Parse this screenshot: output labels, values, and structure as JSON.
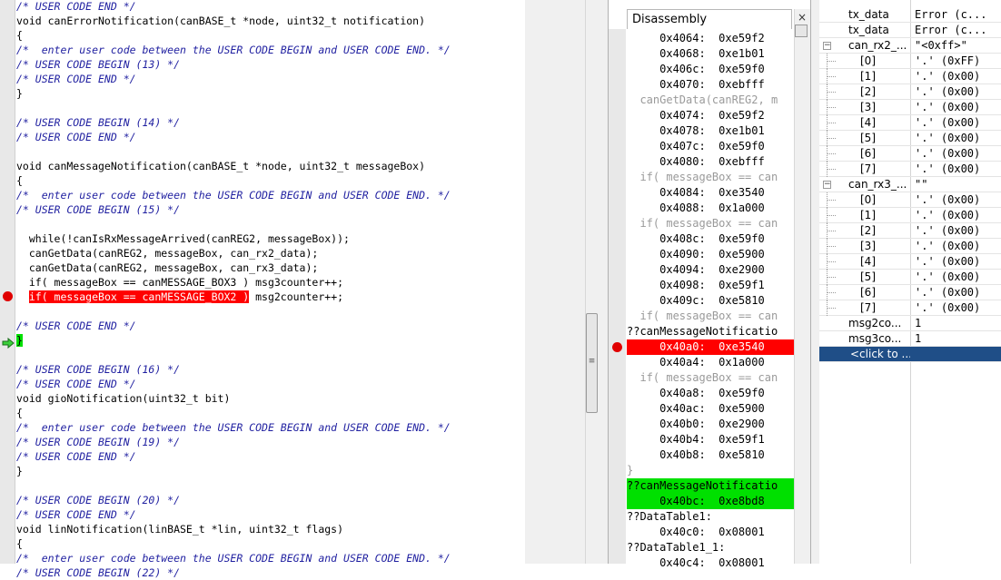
{
  "editor": {
    "lines": [
      {
        "text": "/* USER CODE END */",
        "style": "comment"
      },
      {
        "text": "void canErrorNotification(canBASE_t *node, uint32_t notification)",
        "style": "code"
      },
      {
        "text": "{",
        "style": "code"
      },
      {
        "text": "/*  enter user code between the USER CODE BEGIN and USER CODE END. */",
        "style": "comment"
      },
      {
        "text": "/* USER CODE BEGIN (13) */",
        "style": "comment"
      },
      {
        "text": "/* USER CODE END */",
        "style": "comment"
      },
      {
        "text": "}",
        "style": "code"
      },
      {
        "text": "",
        "style": "code"
      },
      {
        "text": "/* USER CODE BEGIN (14) */",
        "style": "comment"
      },
      {
        "text": "/* USER CODE END */",
        "style": "comment"
      },
      {
        "text": "",
        "style": "code"
      },
      {
        "text": "void canMessageNotification(canBASE_t *node, uint32_t messageBox)",
        "style": "code"
      },
      {
        "text": "{",
        "style": "code"
      },
      {
        "text": "/*  enter user code between the USER CODE BEGIN and USER CODE END. */",
        "style": "comment"
      },
      {
        "text": "/* USER CODE BEGIN (15) */",
        "style": "comment"
      },
      {
        "text": "",
        "style": "code"
      },
      {
        "text": "  while(!canIsRxMessageArrived(canREG2, messageBox));",
        "style": "code"
      },
      {
        "text": "  canGetData(canREG2, messageBox, can_rx2_data);",
        "style": "code"
      },
      {
        "text": "  canGetData(canREG2, messageBox, can_rx3_data);",
        "style": "code"
      },
      {
        "text": "  if( messageBox == canMESSAGE_BOX3 ) msg3counter++;",
        "style": "code"
      },
      {
        "text": "  if( messageBox == canMESSAGE_BOX2 ) msg2counter++;",
        "style": "red",
        "hl": "if( messageBox == canMESSAGE_BOX2 )",
        "rest": " msg2counter++;"
      },
      {
        "text": "",
        "style": "code"
      },
      {
        "text": "/* USER CODE END */",
        "style": "comment"
      },
      {
        "text": "}",
        "style": "green"
      },
      {
        "text": "",
        "style": "code"
      },
      {
        "text": "/* USER CODE BEGIN (16) */",
        "style": "comment"
      },
      {
        "text": "/* USER CODE END */",
        "style": "comment"
      },
      {
        "text": "void gioNotification(uint32_t bit)",
        "style": "code"
      },
      {
        "text": "{",
        "style": "code"
      },
      {
        "text": "/*  enter user code between the USER CODE BEGIN and USER CODE END. */",
        "style": "comment"
      },
      {
        "text": "/* USER CODE BEGIN (19) */",
        "style": "comment"
      },
      {
        "text": "/* USER CODE END */",
        "style": "comment"
      },
      {
        "text": "}",
        "style": "code"
      },
      {
        "text": "",
        "style": "code"
      },
      {
        "text": "/* USER CODE BEGIN (20) */",
        "style": "comment"
      },
      {
        "text": "/* USER CODE END */",
        "style": "comment"
      },
      {
        "text": "void linNotification(linBASE_t *lin, uint32_t flags)",
        "style": "code"
      },
      {
        "text": "{",
        "style": "code"
      },
      {
        "text": "/*  enter user code between the USER CODE BEGIN and USER CODE END. */",
        "style": "comment"
      },
      {
        "text": "/* USER CODE BEGIN (22) */",
        "style": "comment"
      }
    ]
  },
  "disassembly": {
    "title": "Disassembly",
    "close_glyph": "×",
    "lines": [
      {
        "text": "     0x4064:  0xe59f2",
        "style": "addr"
      },
      {
        "text": "     0x4068:  0xe1b01",
        "style": "addr"
      },
      {
        "text": "     0x406c:  0xe59f0",
        "style": "addr"
      },
      {
        "text": "     0x4070:  0xebfff",
        "style": "addr"
      },
      {
        "text": "  canGetData(canREG2, m",
        "style": "src"
      },
      {
        "text": "     0x4074:  0xe59f2",
        "style": "addr"
      },
      {
        "text": "     0x4078:  0xe1b01",
        "style": "addr"
      },
      {
        "text": "     0x407c:  0xe59f0",
        "style": "addr"
      },
      {
        "text": "     0x4080:  0xebfff",
        "style": "addr"
      },
      {
        "text": "  if( messageBox == can",
        "style": "src"
      },
      {
        "text": "     0x4084:  0xe3540",
        "style": "addr"
      },
      {
        "text": "     0x4088:  0x1a000",
        "style": "addr"
      },
      {
        "text": "  if( messageBox == can",
        "style": "src"
      },
      {
        "text": "     0x408c:  0xe59f0",
        "style": "addr"
      },
      {
        "text": "     0x4090:  0xe5900",
        "style": "addr"
      },
      {
        "text": "     0x4094:  0xe2900",
        "style": "addr"
      },
      {
        "text": "     0x4098:  0xe59f1",
        "style": "addr"
      },
      {
        "text": "     0x409c:  0xe5810",
        "style": "addr"
      },
      {
        "text": "  if( messageBox == can",
        "style": "src"
      },
      {
        "text": "??canMessageNotificatio",
        "style": "addr"
      },
      {
        "text": "     0x40a0:  0xe3540",
        "style": "red"
      },
      {
        "text": "     0x40a4:  0x1a000",
        "style": "addr"
      },
      {
        "text": "  if( messageBox == can",
        "style": "src"
      },
      {
        "text": "     0x40a8:  0xe59f0",
        "style": "addr"
      },
      {
        "text": "     0x40ac:  0xe5900",
        "style": "addr"
      },
      {
        "text": "     0x40b0:  0xe2900",
        "style": "addr"
      },
      {
        "text": "     0x40b4:  0xe59f1",
        "style": "addr"
      },
      {
        "text": "     0x40b8:  0xe5810",
        "style": "addr"
      },
      {
        "text": "}",
        "style": "src"
      },
      {
        "text": "??canMessageNotificatio",
        "style": "green"
      },
      {
        "text": "     0x40bc:  0xe8bd8",
        "style": "green"
      },
      {
        "text": "??DataTable1:",
        "style": "addr"
      },
      {
        "text": "     0x40c0:  0x08001",
        "style": "addr"
      },
      {
        "text": "??DataTable1_1:",
        "style": "addr"
      },
      {
        "text": "     0x40c4:  0x08001",
        "style": "addr"
      }
    ]
  },
  "watch": {
    "rows": [
      {
        "name": "tx_data",
        "value": "Error (c...",
        "level": 0,
        "expander": ""
      },
      {
        "name": "tx_data",
        "value": "Error (c...",
        "level": 0,
        "expander": ""
      },
      {
        "name": "can_rx2_...",
        "value": "\"<0xff>\"",
        "level": 0,
        "expander": "−"
      },
      {
        "name": "[0]",
        "value": "'.' (0xFF)",
        "level": 1,
        "expander": ""
      },
      {
        "name": "[1]",
        "value": "'.' (0x00)",
        "level": 1,
        "expander": ""
      },
      {
        "name": "[2]",
        "value": "'.' (0x00)",
        "level": 1,
        "expander": ""
      },
      {
        "name": "[3]",
        "value": "'.' (0x00)",
        "level": 1,
        "expander": ""
      },
      {
        "name": "[4]",
        "value": "'.' (0x00)",
        "level": 1,
        "expander": ""
      },
      {
        "name": "[5]",
        "value": "'.' (0x00)",
        "level": 1,
        "expander": ""
      },
      {
        "name": "[6]",
        "value": "'.' (0x00)",
        "level": 1,
        "expander": ""
      },
      {
        "name": "[7]",
        "value": "'.' (0x00)",
        "level": 1,
        "expander": ""
      },
      {
        "name": "can_rx3_...",
        "value": "\"\"",
        "level": 0,
        "expander": "−"
      },
      {
        "name": "[0]",
        "value": "'.' (0x00)",
        "level": 1,
        "expander": ""
      },
      {
        "name": "[1]",
        "value": "'.' (0x00)",
        "level": 1,
        "expander": ""
      },
      {
        "name": "[2]",
        "value": "'.' (0x00)",
        "level": 1,
        "expander": ""
      },
      {
        "name": "[3]",
        "value": "'.' (0x00)",
        "level": 1,
        "expander": ""
      },
      {
        "name": "[4]",
        "value": "'.' (0x00)",
        "level": 1,
        "expander": ""
      },
      {
        "name": "[5]",
        "value": "'.' (0x00)",
        "level": 1,
        "expander": ""
      },
      {
        "name": "[6]",
        "value": "'.' (0x00)",
        "level": 1,
        "expander": ""
      },
      {
        "name": "[7]",
        "value": "'.' (0x00)",
        "level": 1,
        "expander": ""
      },
      {
        "name": "msg2co...",
        "value": "1",
        "level": 0,
        "expander": ""
      },
      {
        "name": "msg3co...",
        "value": "1",
        "level": 0,
        "expander": ""
      },
      {
        "name": "<click to ...",
        "value": "",
        "level": 0,
        "expander": "",
        "selected": true
      }
    ]
  },
  "colors": {
    "breakpoint": "#e00000",
    "current_line": "#00e000",
    "selection": "#1f4e87",
    "comment": "#1f1fa0"
  }
}
